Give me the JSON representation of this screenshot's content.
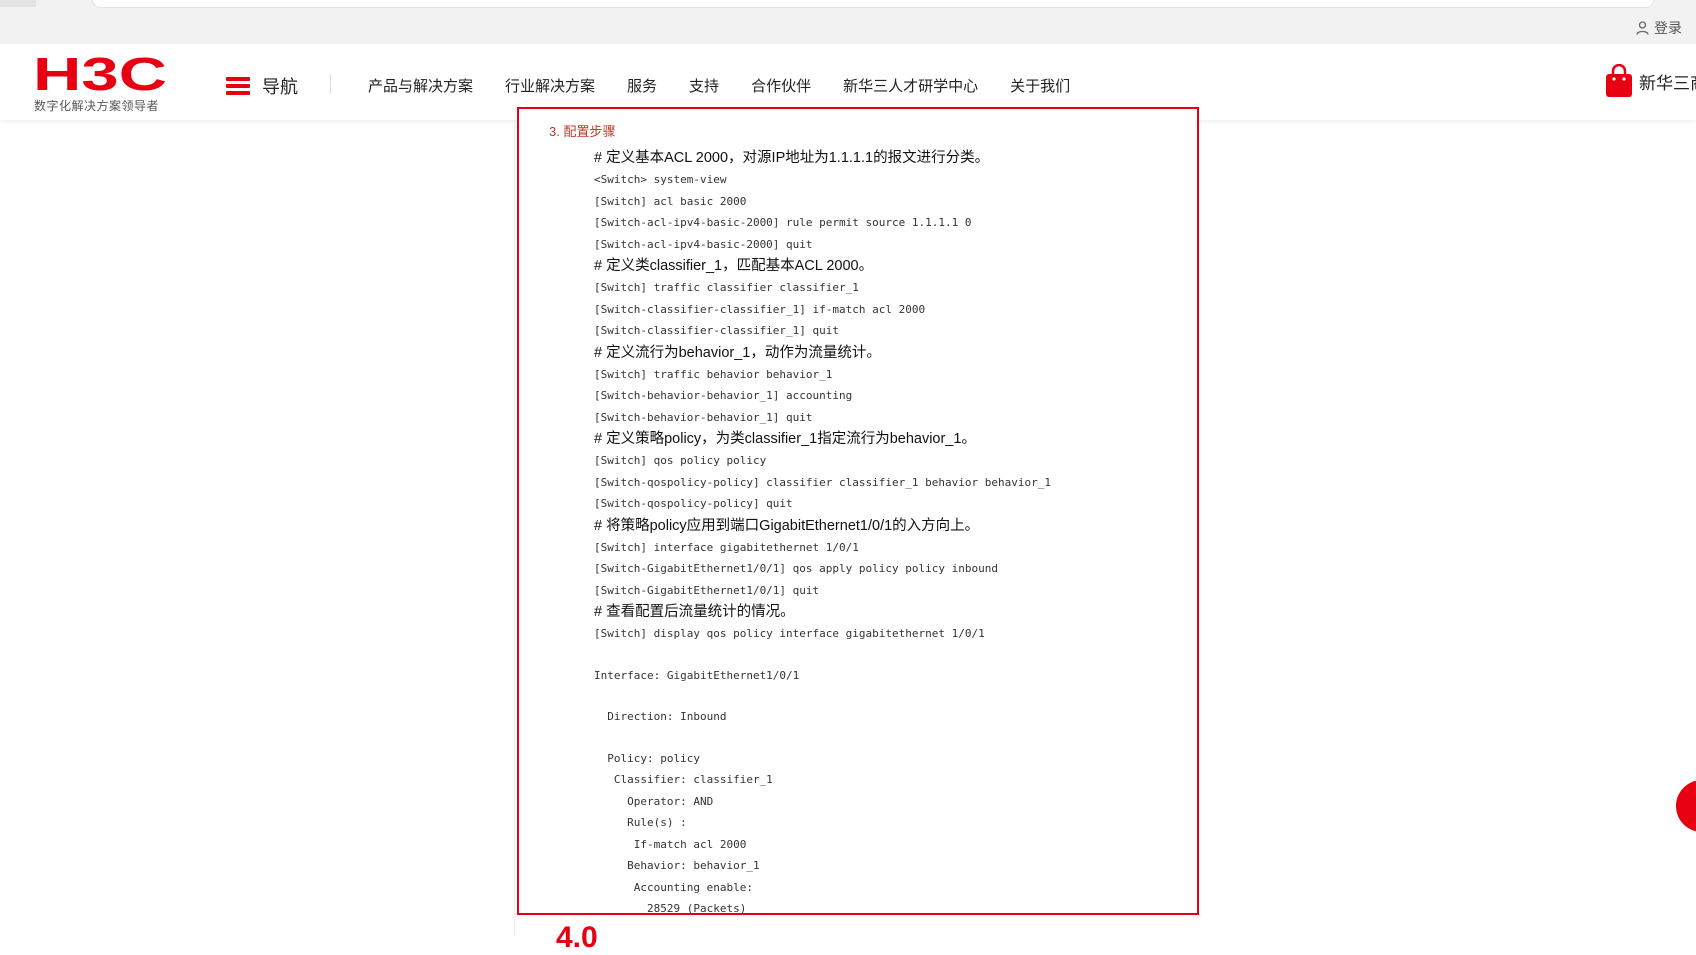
{
  "browser": {
    "login_label": "登录"
  },
  "header": {
    "logo_text": "H3C",
    "slogan": "数字化解决方案领导者",
    "nav_label": "导航",
    "menu": [
      "产品与解决方案",
      "行业解决方案",
      "服务",
      "支持",
      "合作伙伴",
      "新华三人才研学中心",
      "关于我们"
    ],
    "right_label": "新华三商"
  },
  "article": {
    "step_title": "3. 配置步骤",
    "lines": [
      {
        "type": "comment",
        "text": "# 定义基本ACL 2000，对源IP地址为1.1.1.1的报文进行分类。"
      },
      {
        "type": "code",
        "text": "<Switch> system-view"
      },
      {
        "type": "code",
        "text": "[Switch] acl basic 2000"
      },
      {
        "type": "code",
        "text": "[Switch-acl-ipv4-basic-2000] rule permit source 1.1.1.1 0"
      },
      {
        "type": "code",
        "text": "[Switch-acl-ipv4-basic-2000] quit"
      },
      {
        "type": "comment",
        "text": "# 定义类classifier_1，匹配基本ACL 2000。"
      },
      {
        "type": "code",
        "text": "[Switch] traffic classifier classifier_1"
      },
      {
        "type": "code",
        "text": "[Switch-classifier-classifier_1] if-match acl 2000"
      },
      {
        "type": "code",
        "text": "[Switch-classifier-classifier_1] quit"
      },
      {
        "type": "comment",
        "text": "# 定义流行为behavior_1，动作为流量统计。"
      },
      {
        "type": "code",
        "text": "[Switch] traffic behavior behavior_1"
      },
      {
        "type": "code",
        "text": "[Switch-behavior-behavior_1] accounting"
      },
      {
        "type": "code",
        "text": "[Switch-behavior-behavior_1] quit"
      },
      {
        "type": "comment",
        "text": "# 定义策略policy，为类classifier_1指定流行为behavior_1。"
      },
      {
        "type": "code",
        "text": "[Switch] qos policy policy"
      },
      {
        "type": "code",
        "text": "[Switch-qospolicy-policy] classifier classifier_1 behavior behavior_1"
      },
      {
        "type": "code",
        "text": "[Switch-qospolicy-policy] quit"
      },
      {
        "type": "comment",
        "text": "# 将策略policy应用到端口GigabitEthernet1/0/1的入方向上。"
      },
      {
        "type": "code",
        "text": "[Switch] interface gigabitethernet 1/0/1"
      },
      {
        "type": "code",
        "text": "[Switch-GigabitEthernet1/0/1] qos apply policy policy inbound"
      },
      {
        "type": "code",
        "text": "[Switch-GigabitEthernet1/0/1] quit"
      },
      {
        "type": "comment",
        "text": "# 查看配置后流量统计的情况。"
      },
      {
        "type": "code",
        "text": "[Switch] display qos policy interface gigabitethernet 1/0/1"
      },
      {
        "type": "blank",
        "text": ""
      },
      {
        "type": "code",
        "text": "Interface: GigabitEthernet1/0/1"
      },
      {
        "type": "blank",
        "text": ""
      },
      {
        "type": "code",
        "text": "  Direction: Inbound"
      },
      {
        "type": "blank",
        "text": ""
      },
      {
        "type": "code",
        "text": "  Policy: policy"
      },
      {
        "type": "code",
        "text": "   Classifier: classifier_1"
      },
      {
        "type": "code",
        "text": "     Operator: AND"
      },
      {
        "type": "code",
        "text": "     Rule(s) :"
      },
      {
        "type": "code",
        "text": "      If-match acl 2000"
      },
      {
        "type": "code",
        "text": "     Behavior: behavior_1"
      },
      {
        "type": "code",
        "text": "      Accounting enable:"
      },
      {
        "type": "code",
        "text": "        28529 (Packets)"
      }
    ]
  },
  "bottom_heading": "4.0",
  "colors": {
    "brand_red": "#e60012",
    "step_title": "#c0392b"
  },
  "icons": [
    "user-icon",
    "hamburger-icon",
    "shopping-bag-icon"
  ]
}
